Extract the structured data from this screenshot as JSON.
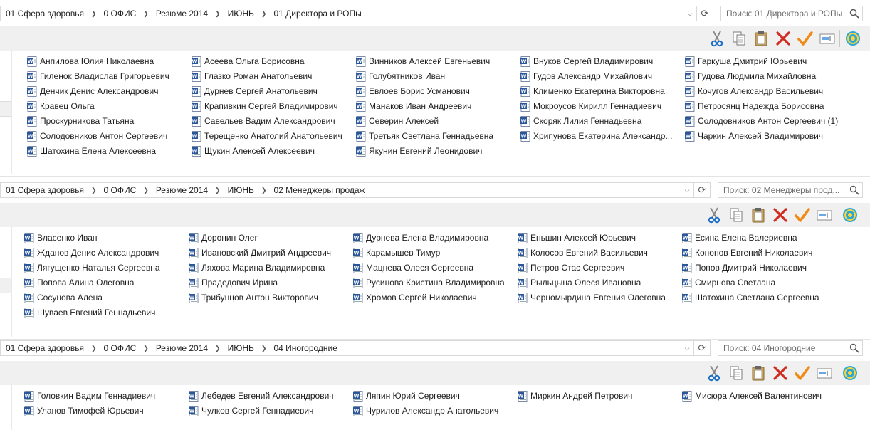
{
  "panels": [
    {
      "breadcrumb": [
        "01 Сфера здоровья",
        "0 ОФИС",
        "Резюме 2014",
        "ИЮНЬ",
        "01 Директора и РОПы"
      ],
      "search_placeholder": "Поиск: 01 Директора и РОПы",
      "columns": [
        [
          "Анпилова Юлия Николаевна",
          "Гиленок Владислав Григорьевич",
          "Денчик Денис Александрович",
          "Кравец Ольга",
          "Проскурникова Татьяна",
          "Солодовников Антон Сергеевич",
          "Шатохина Елена Алексеевна"
        ],
        [
          "Асеева Ольга Борисовна",
          "Глазко Роман Анатольевич",
          "Дурнев Сергей Анатольевич",
          "Крапивкин Сергей Владимирович",
          "Савельев Вадим Александрович",
          "Терещенко Анатолий Анатольевич",
          "Щукин Алексей Алексеевич"
        ],
        [
          "Винников Алексей Евгеньевич",
          "Голубятников Иван",
          "Евлоев Борис Усманович",
          "Манаков Иван Андреевич",
          "Северин Алексей",
          "Третьяк Светлана Геннадьевна",
          "Якунин Евгений Леонидович"
        ],
        [
          "Внуков Сергей Владимирович",
          "Гудов Александр Михайлович",
          "Клименко Екатерина Викторовна",
          "Мокроусов Кирилл Геннадиевич",
          "Скоряк Лилия Геннадьевна",
          "Хрипунова Екатерина Александр..."
        ],
        [
          "Гаркуша Дмитрий Юрьевич",
          "Гудова Людмила Михайловна",
          "Кочугов Александр Васильевич",
          "Петросянц Надежда Борисовна",
          "Солодовников Антон Сергеевич (1)",
          "Чаркин Алексей Владимирович"
        ]
      ]
    },
    {
      "breadcrumb": [
        "01 Сфера здоровья",
        "0 ОФИС",
        "Резюме 2014",
        "ИЮНЬ",
        "02 Менеджеры продаж"
      ],
      "search_placeholder": "Поиск: 02 Менеджеры прод...",
      "columns": [
        [
          "Власенко Иван",
          "Жданов Денис Александрович",
          "Лягущенко Наталья Сергеевна",
          "Попова Алина Олеговна",
          "Сосунова Алена",
          "Шуваев Евгений Геннадьевич"
        ],
        [
          "Доронин Олег",
          "Ивановский Дмитрий Андреевич",
          "Ляхова Марина Владимировна",
          "Прадедович Ирина",
          "Трибунцов Антон Викторович"
        ],
        [
          "Дурнева Елена Владимировна",
          "Карамышев Тимур",
          "Мацнева Олеся Сергеевна",
          "Русинова Кристина Владимировна",
          "Хромов Сергей Николаевич"
        ],
        [
          "Еньшин Алексей Юрьевич",
          "Колосов Евгений Васильевич",
          "Петров Стас Сергеевич",
          "Рыльцына Олеся Ивановна",
          "Черномырдина Евгения Олеговна"
        ],
        [
          "Есина Елена Валериевна",
          "Кононов Евгений Николаевич",
          "Попов Дмитрий Николаевич",
          "Смирнова Светлана",
          "Шатохина Светлана Сергеевна"
        ]
      ]
    },
    {
      "breadcrumb": [
        "01 Сфера здоровья",
        "0 ОФИС",
        "Резюме 2014",
        "ИЮНЬ",
        "04 Иногородние"
      ],
      "search_placeholder": "Поиск: 04 Иногородние",
      "columns": [
        [
          "Головкин Вадим Геннадиевич",
          "Уланов Тимофей Юрьевич"
        ],
        [
          "Лебедев Евгений Александрович",
          "Чулков Сергей Геннадиевич"
        ],
        [
          "Ляпин Юрий Сергеевич",
          "Чурилов Александр Анатольевич"
        ],
        [
          "Миркин Андрей Петрович"
        ],
        [
          "Мисюра Алексей Валентинович"
        ]
      ]
    }
  ],
  "toolbar_icons": [
    "cut-icon",
    "copy-icon",
    "paste-icon",
    "delete-icon",
    "check-icon",
    "rename-icon",
    "shell-icon"
  ],
  "colors": {
    "toolbar_bg": "#f0f0f0",
    "cut": "#1a6fc4",
    "delete": "#d12b1f",
    "check": "#f08a17",
    "shell": "#27a8d8"
  }
}
